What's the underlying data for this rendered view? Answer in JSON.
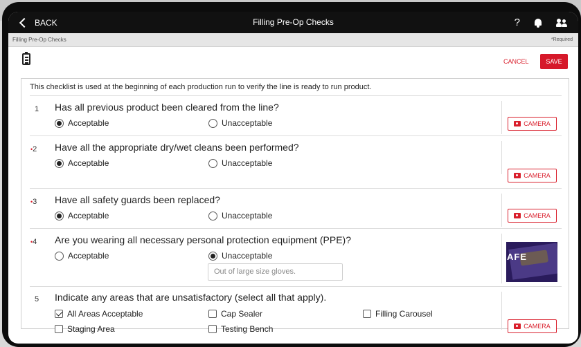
{
  "topbar": {
    "back_label": "BACK",
    "title": "Filling Pre-Op  Checks",
    "help_symbol": "?"
  },
  "subbar": {
    "breadcrumb": "Filling Pre-Op Checks",
    "required_note": "*Required"
  },
  "toolbar": {
    "cancel_label": "CANCEL",
    "save_label": "SAVE"
  },
  "checklist": {
    "intro": "This checklist is used at the beginning of each production run to verify the line is ready to run product.",
    "camera_label": "CAMERA",
    "questions": [
      {
        "number": "1",
        "required": false,
        "text": "Has all previous product been cleared from the line?",
        "options": [
          "Acceptable",
          "Unacceptable"
        ],
        "selected": "Acceptable"
      },
      {
        "number": "2",
        "required": true,
        "text": "Have all the appropriate dry/wet cleans been performed?",
        "options": [
          "Acceptable",
          "Unacceptable"
        ],
        "selected": "Acceptable"
      },
      {
        "number": "3",
        "required": true,
        "text": "Have all safety guards been replaced?",
        "options": [
          "Acceptable",
          "Unacceptable"
        ],
        "selected": "Acceptable"
      },
      {
        "number": "4",
        "required": true,
        "text": "Are you wearing all necessary personal protection equipment (PPE)?",
        "options": [
          "Acceptable",
          "Unacceptable"
        ],
        "selected": "Unacceptable",
        "comment": "Out of large size gloves.",
        "photo_text": "AFE"
      },
      {
        "number": "5",
        "required": false,
        "text": "Indicate any areas that are unsatisfactory (select all that apply).",
        "checkboxes": [
          {
            "label": "All Areas Acceptable",
            "checked": true
          },
          {
            "label": "Cap Sealer",
            "checked": false
          },
          {
            "label": "Filling Carousel",
            "checked": false
          },
          {
            "label": "Staging Area",
            "checked": false
          },
          {
            "label": "Testing Bench",
            "checked": false
          }
        ]
      }
    ]
  },
  "colors": {
    "accent_red": "#d6192a",
    "topbar": "#111111"
  },
  "icons": [
    "back-chevron-icon",
    "help-icon",
    "bell-icon",
    "users-icon",
    "clipboard-icon",
    "camera-icon"
  ]
}
